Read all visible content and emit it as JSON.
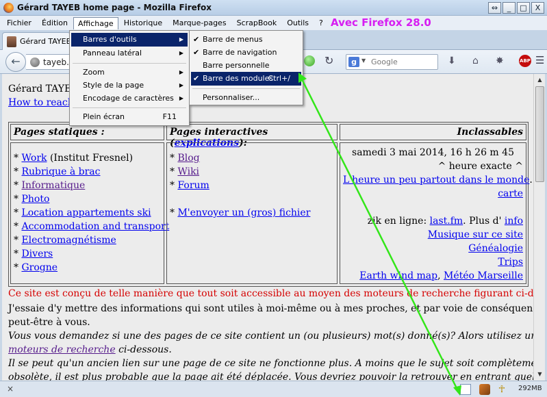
{
  "window": {
    "title": "Gérard TAYEB home page - Mozilla Firefox",
    "btn_restore": "⇔",
    "btn_minimize": "_",
    "btn_maximize": "□",
    "btn_close": "X"
  },
  "menubar": {
    "items": [
      "Fichier",
      "Édition",
      "Affichage",
      "Historique",
      "Marque-pages",
      "ScrapBook",
      "Outils",
      "?"
    ]
  },
  "annotation": "Avec Firefox 28.0",
  "tab": {
    "label": "Gérard TAYEB home page"
  },
  "nav": {
    "url": "tayeb.f",
    "search_placeholder": "Google"
  },
  "affichage_menu": {
    "items": [
      "Barres d'outils",
      "Panneau latéral",
      "Zoom",
      "Style de la page",
      "Encodage de caractères",
      "Plein écran"
    ],
    "fullscreen_shortcut": "F11"
  },
  "toolbars_submenu": {
    "items": [
      "Barre de menus",
      "Barre de navigation",
      "Barre personnelle",
      "Barre des modules"
    ],
    "modules_shortcut": "Ctrl+/",
    "customize": "Personnaliser..."
  },
  "page": {
    "header_name": "Gérard TAYEB",
    "header_link": "How to reach",
    "col1": {
      "header": "Pages statiques :",
      "items": [
        {
          "text": "Work",
          "suffix": " (Institut Fresnel)"
        },
        {
          "text": "Rubrique à brac"
        },
        {
          "text": "Informatique"
        },
        {
          "text": "Photo"
        },
        {
          "text": "Location appartements ski"
        },
        {
          "text": "Accommodation and transport"
        },
        {
          "text": "Electromagnétisme"
        },
        {
          "text": "Divers"
        },
        {
          "text": "Grogne"
        }
      ]
    },
    "col2": {
      "header_prefix": "Pages interactives (",
      "header_link": "explications",
      "header_suffix": "):",
      "items": [
        "Blog",
        "Wiki",
        "Forum"
      ],
      "upload": "M'envoyer un (gros) fichier"
    },
    "col3": {
      "header": "Inclassables",
      "date": "samedi 3 mai 2014, 16 h 26 m 45",
      "exact": "^ heure exacte ^",
      "time_link1": "L'heure un peu partout dans le monde",
      "time_sep": ". ",
      "time_link2_a": "La",
      "time_link2_b": "carte",
      "zik_prefix": "zik en ligne: ",
      "zik_link1": "last.fm",
      "zik_mid": ". Plus d' ",
      "zik_link2": "info",
      "musique": "Musique sur ce site",
      "genealogie": "Généalogie",
      "trips": "Trips",
      "earth": "Earth wind map",
      "earth_sep": ", ",
      "meteo": "Météo Marseille"
    },
    "red_note": "Ce site est conçu de telle manière que tout soit accessible au moyen des moteurs de recherche figurant ci-dessous.",
    "p1a": "J'essaie d'y mettre des informations qui sont utiles à moi-même ou à mes proches, et par voie de conséquence",
    "p1b": "peut-être à vous.",
    "p2a": "Vous vous demandez si une des pages de ce site contient un (ou plusieurs) mot(s) donné(s)? Alors utilisez un des",
    "p2b_link": "moteurs de recherche",
    "p2b_suffix": " ci-dessous.",
    "p3a": "Il se peut qu'un ancien lien sur une page de ce site ne fonctionne plus. A moins que le sujet soit complètement",
    "p3b": "obsolète, il est plus probable que la page ait été déplacée. Vous devriez pouvoir la retrouver en entrant quelques mots"
  },
  "status": {
    "close": "×",
    "memory": "292MB"
  },
  "colors": {
    "highlight": "#0a246a",
    "arrow": "#33e61a",
    "annotation": "#d61ef1",
    "red_note": "#d50000"
  }
}
